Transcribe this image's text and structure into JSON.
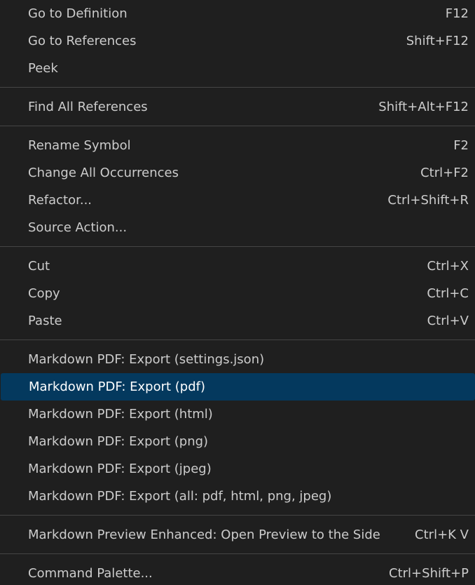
{
  "groups": [
    {
      "items": [
        {
          "label": "Go to Definition",
          "shortcut": "F12"
        },
        {
          "label": "Go to References",
          "shortcut": "Shift+F12"
        },
        {
          "label": "Peek",
          "shortcut": ""
        }
      ]
    },
    {
      "items": [
        {
          "label": "Find All References",
          "shortcut": "Shift+Alt+F12"
        }
      ]
    },
    {
      "items": [
        {
          "label": "Rename Symbol",
          "shortcut": "F2"
        },
        {
          "label": "Change All Occurrences",
          "shortcut": "Ctrl+F2"
        },
        {
          "label": "Refactor...",
          "shortcut": "Ctrl+Shift+R"
        },
        {
          "label": "Source Action...",
          "shortcut": ""
        }
      ]
    },
    {
      "items": [
        {
          "label": "Cut",
          "shortcut": "Ctrl+X"
        },
        {
          "label": "Copy",
          "shortcut": "Ctrl+C"
        },
        {
          "label": "Paste",
          "shortcut": "Ctrl+V"
        }
      ]
    },
    {
      "items": [
        {
          "label": "Markdown PDF: Export (settings.json)",
          "shortcut": ""
        },
        {
          "label": "Markdown PDF: Export (pdf)",
          "shortcut": "",
          "selected": true
        },
        {
          "label": "Markdown PDF: Export (html)",
          "shortcut": ""
        },
        {
          "label": "Markdown PDF: Export (png)",
          "shortcut": ""
        },
        {
          "label": "Markdown PDF: Export (jpeg)",
          "shortcut": ""
        },
        {
          "label": "Markdown PDF: Export (all: pdf, html, png, jpeg)",
          "shortcut": ""
        }
      ]
    },
    {
      "items": [
        {
          "label": "Markdown Preview Enhanced: Open Preview to the Side",
          "shortcut": "Ctrl+K V"
        }
      ]
    },
    {
      "items": [
        {
          "label": "Command Palette...",
          "shortcut": "Ctrl+Shift+P"
        }
      ]
    }
  ],
  "colors": {
    "background": "#1f1f1f",
    "text": "#cccccc",
    "selected_background": "#04395e",
    "separator": "#454545"
  }
}
